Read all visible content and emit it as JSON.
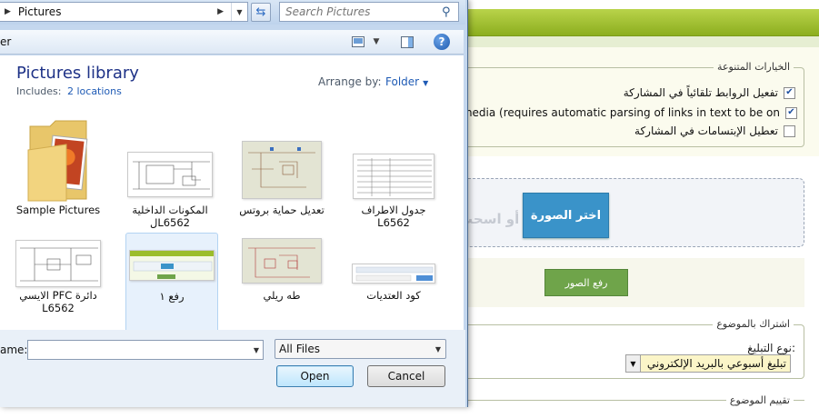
{
  "background": {
    "options_legend": "الخيارات المتنوعة",
    "options": [
      {
        "label": "تفعيل الروابط تلقائياً في المشاركة",
        "checked": true
      },
      {
        "label": "bed media (requires automatic parsing of links in text to be on",
        "checked": true
      },
      {
        "label": "تعطيل الإبتسامات في المشاركة",
        "checked": false
      }
    ],
    "choose_image_button": "اختر الصورة",
    "drag_text": "أو اسحب",
    "upload_images_button": "رفع الصور",
    "subscription_legend": "اشتراك بالموضوع",
    "notification_type_label": "نوع التبليغ:",
    "notification_type_value": "تبليغ أسبوعي بالبريد الإلكتروني",
    "rating_legend": "تقييم الموضوع",
    "colors": {
      "green_bar": "#9bbd2c",
      "choose_btn": "#3a93c9",
      "upload_btn": "#6fa44a"
    }
  },
  "dialog": {
    "address": {
      "separator_icon": "play-right-icon",
      "path": "Pictures"
    },
    "search": {
      "placeholder": "Search Pictures"
    },
    "toolbar_cut_text": "er",
    "library": {
      "title": "Pictures library",
      "includes_label": "Includes:",
      "locations_link": "2 locations",
      "arrange_label": "Arrange by:",
      "arrange_value": "Folder"
    },
    "items": [
      {
        "label": "Sample Pictures",
        "kind": "folder"
      },
      {
        "label": "المكونات الداخلية\nلL6562",
        "kind": "schematic"
      },
      {
        "label": "تعديل حماية بروتس",
        "kind": "schematic"
      },
      {
        "label": "جدول الاطراف\nL6562",
        "kind": "table"
      },
      {
        "label": "الايسي PFC دائرة\nL6562",
        "kind": "schematic"
      },
      {
        "label": "رفع ١",
        "kind": "screenshot",
        "selected": true
      },
      {
        "label": "طه ريلي",
        "kind": "schematic"
      },
      {
        "label": "كود العتديات",
        "kind": "screenshot"
      }
    ],
    "filename_label": "ame:",
    "filename_value": "",
    "filetype_value": "All Files",
    "open_button": "Open",
    "cancel_button": "Cancel"
  }
}
